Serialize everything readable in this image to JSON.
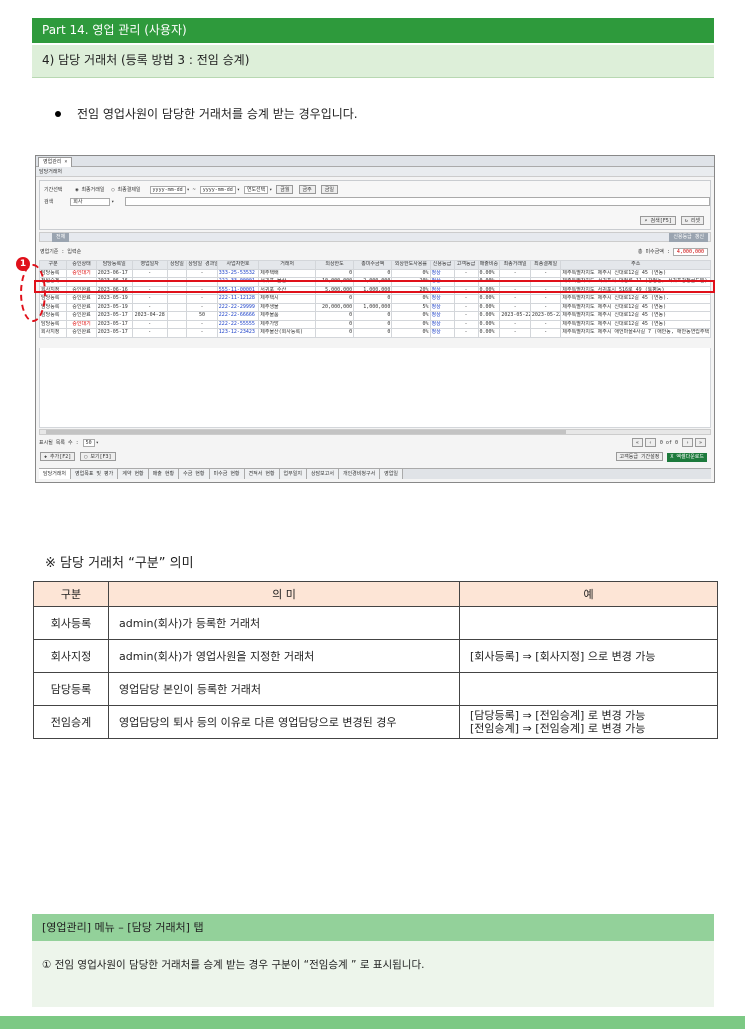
{
  "header": {
    "part_title": "Part 14. 영업 관리 (사용자)",
    "section_title": "4) 담당 거래처 (등록 방법 3 : 전임 승계)"
  },
  "bullet_text": "전임 영업사원이 담당한 거래처를 승계 받는 경우입니다.",
  "screenshot": {
    "tab_label": "영업관리 ×",
    "subtitle": "담당거래처",
    "period_label": "기간선택",
    "radio1": "최종거래일",
    "radio2": "최종결제일",
    "date_from": "yyyy-mm-dd",
    "date_to": "yyyy-mm-dd",
    "year_select": "연도선택",
    "btn_today": "금월",
    "btn_prev": "금주",
    "btn_day": "금일",
    "search_label": "검색",
    "search_select": "회사",
    "btn_search": "검색[F5]",
    "btn_reset": "리셋",
    "btn_all": "전체",
    "btn_grade": "신용등급 갱신",
    "biz_label": "영업기준 : 입력순",
    "total_label": "총 미수금액 :",
    "total_value": "4,000,000",
    "columns": [
      "구분",
      "승인상태",
      "담당등록일",
      "영업일자",
      "상담일",
      "상담일 경과일수",
      "사업자번호",
      "거래처",
      "외상한도",
      "총미수금액",
      "외상한도사용률",
      "신용등급",
      "고객등급",
      "매출비중",
      "최종거래일",
      "최종결제일",
      "주소"
    ],
    "rows": [
      [
        "담당등록",
        "승인대기",
        "2023-06-17",
        "-",
        "",
        "-",
        "333-25-53532",
        "제주택배",
        "0",
        "0",
        "0%",
        "정상",
        "-",
        "0.00%",
        "-",
        "-",
        "제주특별자치도 제주시 신대로12길 45 (연동)"
      ],
      [
        "전임승계",
        "-",
        "2023-06-16",
        "-",
        "",
        "-",
        "222-33-00001",
        "서귀포 물산",
        "10,000,000",
        "2,000,000",
        "20%",
        "정상",
        "-",
        "0.00%",
        "-",
        "-",
        "제주특별자치도 서귀포시 대청로 11 (강정동, 서귀포강정골드빌)"
      ],
      [
        "회사지정",
        "승인완료",
        "2023-06-16",
        "-",
        "",
        "-",
        "555-11-00001",
        "서귀포 수산",
        "5,000,000",
        "1,000,000",
        "20%",
        "정상",
        "-",
        "0.00%",
        "-",
        "-",
        "제주특별자치도 서귀포시 516로 49 (토평동)"
      ],
      [
        "담당등록",
        "승인완료",
        "2023-05-19",
        "-",
        "",
        "-",
        "222-11-12128",
        "제주택시",
        "0",
        "0",
        "0%",
        "정상",
        "-",
        "0.00%",
        "-",
        "-",
        "제주특별자치도 제주시 신대로12길 45 (연동)."
      ],
      [
        "담당등록",
        "승인완료",
        "2023-05-19",
        "-",
        "",
        "-",
        "222-22-29999",
        "제주생물",
        "20,000,000",
        "1,000,000",
        "5%",
        "정상",
        "-",
        "0.00%",
        "-",
        "-",
        "제주특별자치도 제주시 신대로12길 45 (연동)"
      ],
      [
        "담당등록",
        "승인완료",
        "2023-05-17",
        "2023-04-28",
        "",
        "50",
        "222-22-66666",
        "제주물품",
        "0",
        "0",
        "0%",
        "정상",
        "-",
        "0.00%",
        "2023-05-22",
        "2023-05-22",
        "제주특별자치도 제주시 신대로12길 45 (연동)"
      ],
      [
        "담당등록",
        "승인대기",
        "2023-05-17",
        "-",
        "",
        "-",
        "222-22-55555",
        "제주가방",
        "0",
        "0",
        "0%",
        "정상",
        "-",
        "0.00%",
        "-",
        "-",
        "제주특별자치도 제주시 신대로12길 45 (연동)"
      ],
      [
        "회사지정",
        "승인완료",
        "2023-05-17",
        "-",
        "",
        "-",
        "123-12-23423",
        "제주물산(회사등록)",
        "0",
        "0",
        "0%",
        "정상",
        "-",
        "0.00%",
        "-",
        "-",
        "제주특별자치도 제주시 애언마을4사길 7 (애안동, 애안동연립주택)"
      ]
    ],
    "page_size_label": "표시될 목록 수 :",
    "page_size_value": "50",
    "pager_text": "0 of 0",
    "btn_add": "추가[F2]",
    "btn_view": "보기[F3]",
    "btn_customer_grade": "고객등급 기간설정",
    "btn_excel": "엑셀다운로드",
    "bottom_tabs": [
      "담당거래처",
      "영업목표 및 평가",
      "계약 현황",
      "매출 현황",
      "수금 현황",
      "미수금 현황",
      "견적서 현황",
      "업무일지",
      "상담보고서",
      "개인경비청구서",
      "영업일"
    ]
  },
  "marker_number": "1",
  "meaning_note": "※ 담당 거래처 “구분” 의미",
  "meaning_table": {
    "headers": [
      "구분",
      "의 미",
      "예"
    ],
    "rows": [
      {
        "k": "회사등록",
        "m": "admin(회사)가 등록한 거래처",
        "e1": "",
        "e2": ""
      },
      {
        "k": "회사지정",
        "m": "admin(회사)가 영업사원을 지정한 거래처",
        "e1": "[회사등록] ⇒ [회사지정]   으로 변경 가능",
        "e2": ""
      },
      {
        "k": "담당등록",
        "m": "영업담당 본인이 등록한 거래처",
        "e1": "",
        "e2": ""
      },
      {
        "k": "전임승계",
        "m": "영업담당의 퇴사 등의 이유로 다른 영업담당으로 변경된 경우",
        "e1": "[담당등록] ⇒ [전임승계] 로 변경 가능",
        "e2": "[전임승계] ⇒ [전임승계] 로 변경 가능"
      }
    ]
  },
  "section2": {
    "title": "[영업관리] 메뉴 – [담당 거래처] 탭",
    "body": "①  전임 영업사원이 담당한 거래처를 승계 받는 경우 구분이 “전임승계 ” 로 표시됩니다."
  },
  "colors": {
    "header_dark": "#2e9a3c",
    "header_light": "#ddefd9",
    "highlight_red": "#e0101a",
    "table_header": "#fde5d6",
    "section2_header": "#93d19a"
  }
}
